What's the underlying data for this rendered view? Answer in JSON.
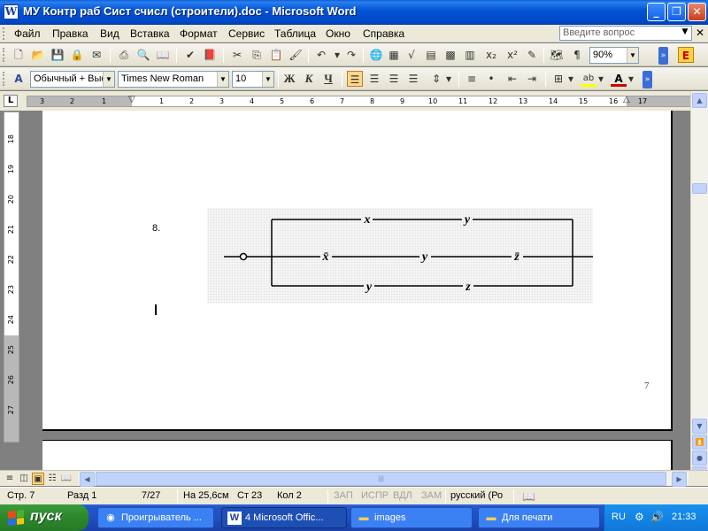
{
  "window": {
    "icon_letter": "W",
    "title": "МУ Контр раб Сист счисл (строители).doc - Microsoft Word",
    "minimize_glyph": "_",
    "maximize_glyph": "❐",
    "close_glyph": "✕"
  },
  "menu": {
    "items": [
      "Файл",
      "Правка",
      "Вид",
      "Вставка",
      "Формат",
      "Сервис",
      "Таблица",
      "Окно",
      "Справка"
    ],
    "help_placeholder": "Введите вопрос"
  },
  "standard_toolbar": {
    "zoom": "90%"
  },
  "format_toolbar": {
    "style": "Обычный + Выс",
    "font": "Times New Roman",
    "size": "10",
    "bold_glyph": "Ж",
    "italic_glyph": "К",
    "underline_glyph": "Ч",
    "font_color_glyph": "A",
    "highlight_glyph": "ab"
  },
  "ruler": {
    "h_numbers": [
      "3",
      "2",
      "1",
      "1",
      "2",
      "3",
      "4",
      "5",
      "6",
      "7",
      "8",
      "9",
      "10",
      "11",
      "12",
      "13",
      "14",
      "15",
      "16",
      "17"
    ],
    "v_numbers": [
      "18",
      "19",
      "20",
      "21",
      "22",
      "23",
      "24",
      "25",
      "26",
      "27"
    ]
  },
  "document": {
    "item_number": "8.",
    "page_number": "7",
    "circuit": {
      "top_branch": [
        "x",
        "y"
      ],
      "middle_branch": [
        "x̄",
        "y",
        "z̄"
      ],
      "bottom_branch": [
        "y",
        "z"
      ]
    }
  },
  "status": {
    "page": "Стр. 7",
    "section": "Разд 1",
    "pages": "7/27",
    "at": "На 25,6см",
    "line": "Ст 23",
    "col": "Кол 2",
    "rec": "ЗАП",
    "trk": "ИСПР",
    "ext": "ВДЛ",
    "ovr": "ЗАМ",
    "language": "русский (Ро"
  },
  "taskbar": {
    "start_label": "пуск",
    "tasks": [
      {
        "label": "Проигрыватель ...",
        "icon": "media-player-icon"
      },
      {
        "label": "4 Microsoft Offic...",
        "icon": "word-icon"
      },
      {
        "label": "images",
        "icon": "folder-icon"
      },
      {
        "label": "Для печати",
        "icon": "folder-icon"
      }
    ],
    "lang": "RU",
    "time": "21:33"
  }
}
